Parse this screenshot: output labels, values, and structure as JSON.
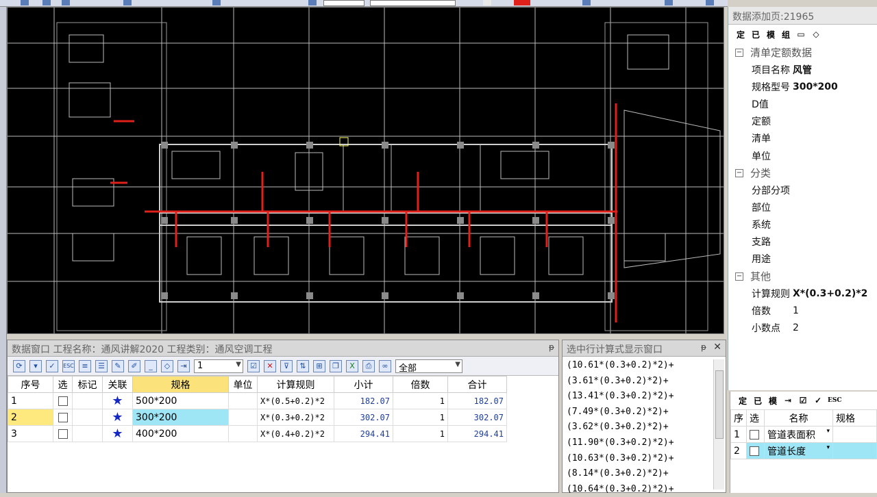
{
  "property_panel": {
    "title": "数据添加页:21965",
    "toolbar": [
      "定",
      "已",
      "模",
      "组",
      "",
      ""
    ],
    "sections": [
      {
        "name": "清单定额数据",
        "rows": [
          {
            "key": "项目名称",
            "value": "风管",
            "bold": true
          },
          {
            "key": "规格型号",
            "value": "300*200",
            "bold": true
          },
          {
            "key": "D值",
            "value": ""
          },
          {
            "key": "定额",
            "value": ""
          },
          {
            "key": "清单",
            "value": ""
          },
          {
            "key": "单位",
            "value": ""
          }
        ]
      },
      {
        "name": "分类",
        "rows": [
          {
            "key": "分部分项",
            "value": ""
          },
          {
            "key": "部位",
            "value": ""
          },
          {
            "key": "系统",
            "value": ""
          },
          {
            "key": "支路",
            "value": ""
          },
          {
            "key": "用途",
            "value": ""
          }
        ]
      },
      {
        "name": "其他",
        "rows": [
          {
            "key": "计算规则",
            "value": "X*(0.3+0.2)*2",
            "bold": true
          },
          {
            "key": "倍数",
            "value": "1"
          },
          {
            "key": "小数点",
            "value": "2"
          }
        ]
      }
    ]
  },
  "mini_table": {
    "toolbar": [
      "定",
      "已",
      "模"
    ],
    "headers": [
      "序",
      "选",
      "名称",
      "规格"
    ],
    "rows": [
      {
        "idx": "1",
        "name": "管道表面积"
      },
      {
        "idx": "2",
        "name": "管道长度"
      }
    ]
  },
  "data_window": {
    "title": "数据窗口  工程名称：通风讲解2020  工程类别：通风空调工程",
    "pin": "ᵽ",
    "multiplier_value": "1",
    "filter_value": "全部",
    "headers": [
      "序号",
      "选",
      "标记",
      "关联",
      "规格",
      "单位",
      "计算规则",
      "小计",
      "倍数",
      "合计"
    ],
    "rows": [
      {
        "idx": "1",
        "spec": "500*200",
        "rule": "X*(0.5+0.2)*2",
        "subtotal": "182.07",
        "multiple": "1",
        "total": "182.07"
      },
      {
        "idx": "2",
        "spec": "300*200",
        "rule": "X*(0.3+0.2)*2",
        "subtotal": "302.07",
        "multiple": "1",
        "total": "302.07"
      },
      {
        "idx": "3",
        "spec": "400*200",
        "rule": "X*(0.4+0.2)*2",
        "subtotal": "294.41",
        "multiple": "1",
        "total": "294.41"
      }
    ],
    "selected_row": 1
  },
  "formula_window": {
    "title": "选中行计算式显示窗口",
    "pin": "ᵽ",
    "close": "✕",
    "lines": [
      "(10.61*(0.3+0.2)*2)+",
      "(3.61*(0.3+0.2)*2)+",
      "(13.41*(0.3+0.2)*2)+",
      "(7.49*(0.3+0.2)*2)+",
      "(3.62*(0.3+0.2)*2)+",
      "(11.90*(0.3+0.2)*2)+",
      "(10.63*(0.3+0.2)*2)+",
      "(8.14*(0.3+0.2)*2)+",
      "(10.64*(0.3+0.2)*2)+"
    ]
  },
  "colors": {
    "duct_red": "#e0201a",
    "cad_line": "#bdbdbd",
    "selected_cell": "#9ee6f6",
    "header_highlight": "#fbe27a"
  }
}
